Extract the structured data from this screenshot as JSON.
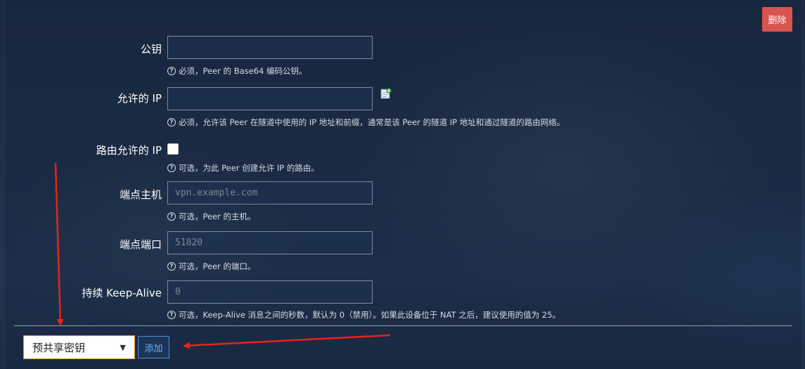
{
  "delete_button": "删除",
  "fields": {
    "public_key": {
      "label": "公钥",
      "value": "",
      "placeholder": "",
      "hint": "必须，Peer 的 Base64 编码公钥。"
    },
    "allowed_ips": {
      "label": "允许的 IP",
      "value": "",
      "placeholder": "",
      "hint": "必须，允许该 Peer 在隧道中使用的 IP 地址和前缀，通常是该 Peer 的隧道 IP 地址和通过隧道的路由网络。"
    },
    "route_allowed_ips": {
      "label": "路由允许的 IP",
      "checked": false,
      "hint": "可选，为此 Peer 创建允许 IP 的路由。"
    },
    "endpoint_host": {
      "label": "端点主机",
      "value": "",
      "placeholder": "vpn.example.com",
      "hint": "可选，Peer 的主机。"
    },
    "endpoint_port": {
      "label": "端点端口",
      "value": "",
      "placeholder": "51820",
      "hint": "可选，Peer 的端口。"
    },
    "keepalive": {
      "label": "持续 Keep-Alive",
      "value": "",
      "placeholder": "0",
      "hint": "可选，Keep-Alive 消息之间的秒数，默认为 0（禁用）。如果此设备位于 NAT 之后，建议使用的值为 25。"
    }
  },
  "footer": {
    "select_value": "预共享密钥",
    "add_button": "添加"
  },
  "icons": {
    "hint": "question-circle-icon",
    "add_ip": "add-entry-icon",
    "annotation": "red-arrow"
  },
  "colors": {
    "danger": "#d9534f",
    "annotation": "#e8231c",
    "select_border": "#f08c1e",
    "link_blue": "#6fb2f2"
  }
}
